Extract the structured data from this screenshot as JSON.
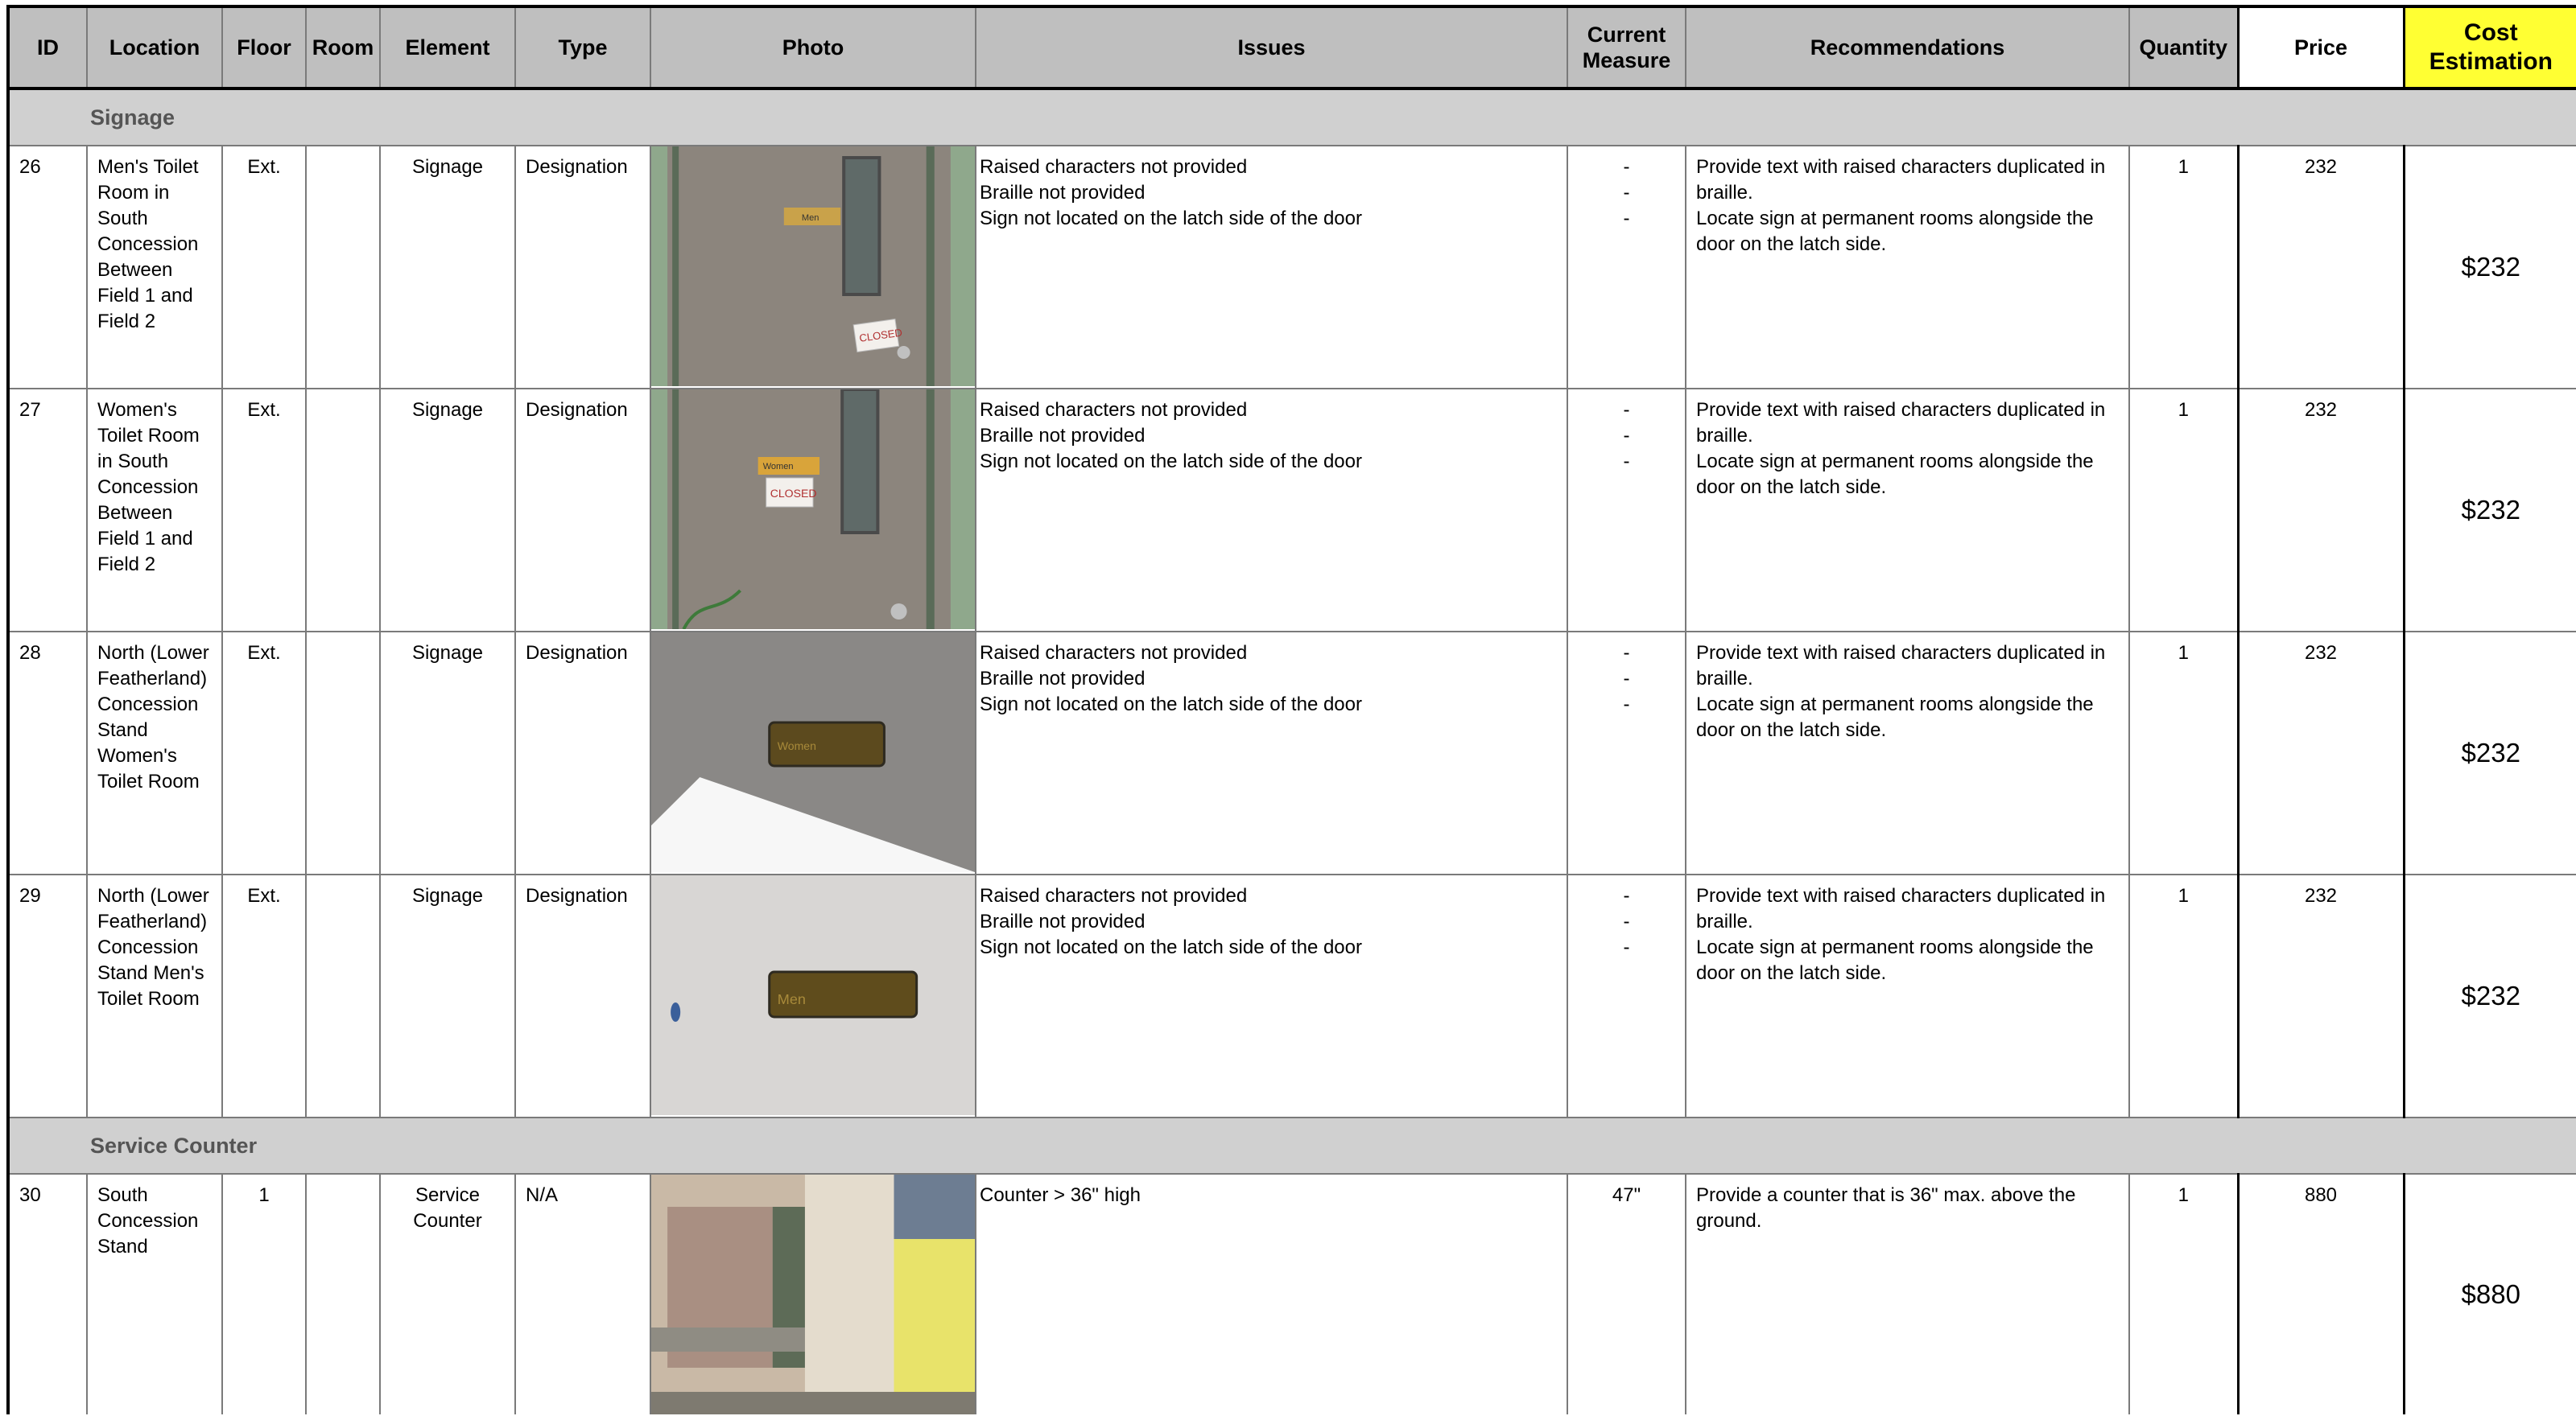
{
  "header": {
    "id": "ID",
    "location": "Location",
    "floor": "Floor",
    "room": "Room",
    "element": "Element",
    "type": "Type",
    "photo": "Photo",
    "issues": "Issues",
    "current_measure_1": "Current",
    "current_measure_2": "Measure",
    "recommendations": "Recommendations",
    "quantity": "Quantity",
    "price": "Price",
    "cost_estimation_1": "Cost",
    "cost_estimation_2": "Estimation"
  },
  "colors": {
    "header_bg": "#bfbfbf",
    "section_bg": "#d0d0d0",
    "cost_header_bg": "#ffff33"
  },
  "sections": [
    {
      "title": "Signage",
      "rows": [
        {
          "id": "26",
          "location": "Men's Toilet Room in South Concession Between Field 1 and Field 2",
          "floor": "Ext.",
          "room": "",
          "element": "Signage",
          "type": "Designation",
          "photo": {
            "icon": "door-with-sign-photo",
            "sign_text": "Men",
            "notice_text": "CLOSED"
          },
          "issues": [
            "Raised characters not provided",
            "Braille not provided",
            "Sign not located on the latch side of the door"
          ],
          "current_measure": [
            "-",
            "-",
            "-"
          ],
          "recommendations": [
            "Provide text with raised characters duplicated in braille.",
            "Locate sign at permanent rooms alongside the door on the latch side."
          ],
          "quantity": "1",
          "price": "232",
          "cost": "$232"
        },
        {
          "id": "27",
          "location": "Women's Toilet Room in South Concession Between Field 1 and Field 2",
          "floor": "Ext.",
          "room": "",
          "element": "Signage",
          "type": "Designation",
          "photo": {
            "icon": "door-with-sign-photo",
            "sign_text": "Women",
            "notice_text": "CLOSED"
          },
          "issues": [
            "Raised characters not provided",
            "Braille not provided",
            "Sign not located on the latch side of the door"
          ],
          "current_measure": [
            "-",
            "-",
            "-"
          ],
          "recommendations": [
            "Provide text with raised characters duplicated in braille.",
            "Locate sign at permanent rooms alongside the door on the latch side."
          ],
          "quantity": "1",
          "price": "232",
          "cost": "$232"
        },
        {
          "id": "28",
          "location": "North (Lower Featherland) Concession Stand Women's Toilet Room",
          "floor": "Ext.",
          "room": "",
          "element": "Signage",
          "type": "Designation",
          "photo": {
            "icon": "wall-sign-photo",
            "sign_text": "Women"
          },
          "issues": [
            "Raised characters not provided",
            "Braille not provided",
            "Sign not located on the latch side of the door"
          ],
          "current_measure": [
            "-",
            "-",
            "-"
          ],
          "recommendations": [
            "Provide text with raised characters duplicated in braille.",
            "Locate sign at permanent rooms alongside the door on the latch side."
          ],
          "quantity": "1",
          "price": "232",
          "cost": "$232"
        },
        {
          "id": "29",
          "location": "North (Lower Featherland) Concession Stand Men's Toilet Room",
          "floor": "Ext.",
          "room": "",
          "element": "Signage",
          "type": "Designation",
          "photo": {
            "icon": "wall-sign-photo",
            "sign_text": "Men"
          },
          "issues": [
            "Raised characters not provided",
            "Braille not provided",
            "Sign not located on the latch side of the door"
          ],
          "current_measure": [
            "-",
            "-",
            "-"
          ],
          "recommendations": [
            "Provide text with raised characters duplicated in braille.",
            "Locate sign at permanent rooms alongside the door on the latch side."
          ],
          "quantity": "1",
          "price": "232",
          "cost": "$232"
        }
      ]
    },
    {
      "title": "Service Counter",
      "rows": [
        {
          "id": "30",
          "location": "South Concession Stand",
          "floor": "1",
          "room": "",
          "element": "Service Counter",
          "type": "N/A",
          "photo": {
            "icon": "service-counter-photo"
          },
          "issues": [
            "Counter > 36\" high"
          ],
          "current_measure": [
            "47\""
          ],
          "recommendations": [
            "Provide a counter that is 36\" max. above the ground."
          ],
          "quantity": "1",
          "price": "880",
          "cost": "$880"
        }
      ]
    }
  ]
}
